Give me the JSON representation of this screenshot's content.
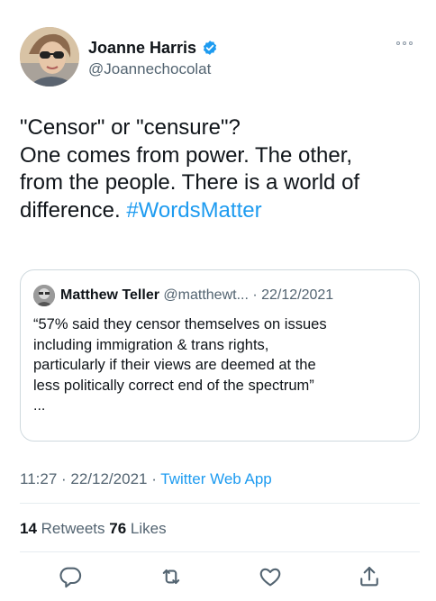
{
  "author": {
    "name": "Joanne Harris",
    "handle": "@Joannechocolat"
  },
  "tweet": {
    "lines": [
      "\"Censor\" or \"censure\"?",
      "One comes from power. The other,",
      "from the people. There is a world of",
      "difference. "
    ],
    "hashtag": "#WordsMatter"
  },
  "quote": {
    "name": "Matthew Teller",
    "handle": "@matthewt...",
    "separator": " · ",
    "date": "22/12/2021",
    "lines": [
      "“57% said they censor themselves on issues",
      "including immigration & trans rights,",
      "particularly if their views are deemed at the",
      "less politically correct end of the spectrum”"
    ],
    "ellipsis": "..."
  },
  "meta": {
    "time": "11:27",
    "separator1": " · ",
    "date": "22/12/2021",
    "separator2": " · ",
    "source": "Twitter Web App"
  },
  "stats": {
    "retweets_count": "14",
    "retweets_label": " Retweets  ",
    "likes_count": "76",
    "likes_label": " Likes"
  },
  "icons": {
    "verified": "verified-badge-icon",
    "more": "more-icon",
    "reply": "reply-icon",
    "retweet": "retweet-icon",
    "like": "heart-icon",
    "share": "share-icon"
  },
  "colors": {
    "accent": "#1d9bf0",
    "text": "#0f1419",
    "secondary": "#536471",
    "border": "#cfd9de"
  }
}
